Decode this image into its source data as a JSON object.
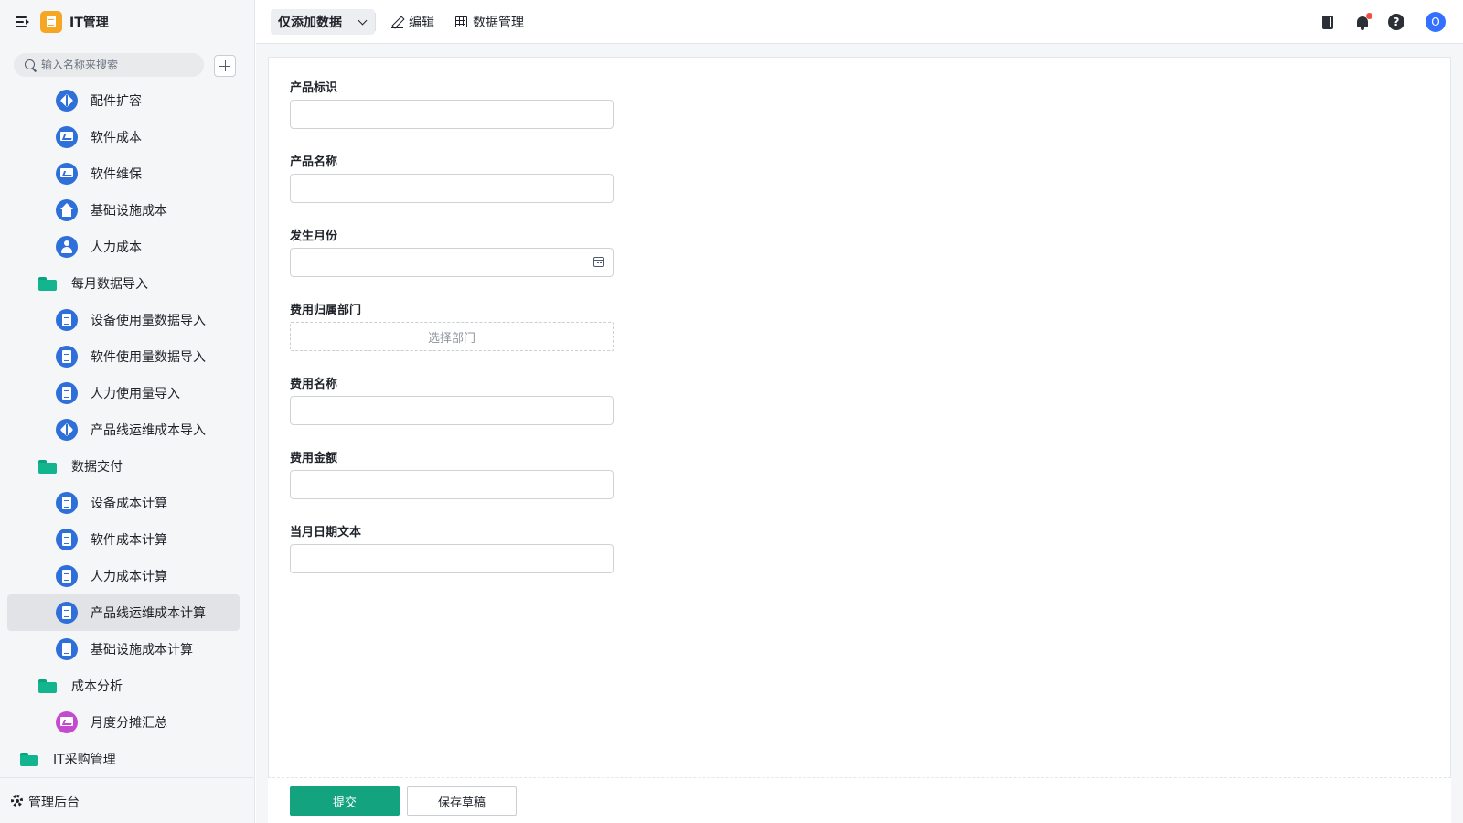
{
  "app": {
    "title": "IT管理"
  },
  "search": {
    "placeholder": "输入名称来搜索"
  },
  "sidebar": {
    "items": [
      {
        "label": "配件扩容",
        "icon": "cube-icon"
      },
      {
        "label": "软件成本",
        "icon": "chart-icon"
      },
      {
        "label": "软件维保",
        "icon": "chart-icon"
      },
      {
        "label": "基础设施成本",
        "icon": "home-icon"
      },
      {
        "label": "人力成本",
        "icon": "person-icon"
      },
      {
        "label": "每月数据导入",
        "icon": "folder-icon"
      },
      {
        "label": "设备使用量数据导入",
        "icon": "doc-icon"
      },
      {
        "label": "软件使用量数据导入",
        "icon": "doc-icon"
      },
      {
        "label": "人力使用量导入",
        "icon": "doc-icon"
      },
      {
        "label": "产品线运维成本导入",
        "icon": "cube-icon"
      },
      {
        "label": "数据交付",
        "icon": "folder-icon"
      },
      {
        "label": "设备成本计算",
        "icon": "doc-icon"
      },
      {
        "label": "软件成本计算",
        "icon": "doc-icon"
      },
      {
        "label": "人力成本计算",
        "icon": "doc-icon"
      },
      {
        "label": "产品线运维成本计算",
        "icon": "doc-icon",
        "active": true
      },
      {
        "label": "基础设施成本计算",
        "icon": "doc-icon"
      },
      {
        "label": "成本分析",
        "icon": "folder-icon"
      },
      {
        "label": "月度分摊汇总",
        "icon": "chart-icon"
      },
      {
        "label": "IT采购管理",
        "icon": "folder-icon"
      }
    ],
    "footer": {
      "label": "管理后台",
      "icon": "gear-icon"
    }
  },
  "toolbar": {
    "view_select": "仅添加数据",
    "edit_label": "编辑",
    "data_manage_label": "数据管理",
    "avatar_initial": "O",
    "help_glyph": "?"
  },
  "form": {
    "fields": [
      {
        "label": "产品标识",
        "value": ""
      },
      {
        "label": "产品名称",
        "value": ""
      },
      {
        "label": "发生月份",
        "value": ""
      },
      {
        "label": "费用归属部门",
        "placeholder": "选择部门"
      },
      {
        "label": "费用名称",
        "value": ""
      },
      {
        "label": "费用金额",
        "value": ""
      },
      {
        "label": "当月日期文本",
        "value": ""
      }
    ],
    "submit_label": "提交",
    "draft_label": "保存草稿"
  },
  "colors": {
    "accent": "#14a37f",
    "nav_icon": "#2f6fd9",
    "folder": "#12b58d",
    "app_logo": "#f5a623",
    "notification_dot": "#f54a45",
    "avatar": "#3370ff",
    "purple_icon": "#c44bcf"
  }
}
